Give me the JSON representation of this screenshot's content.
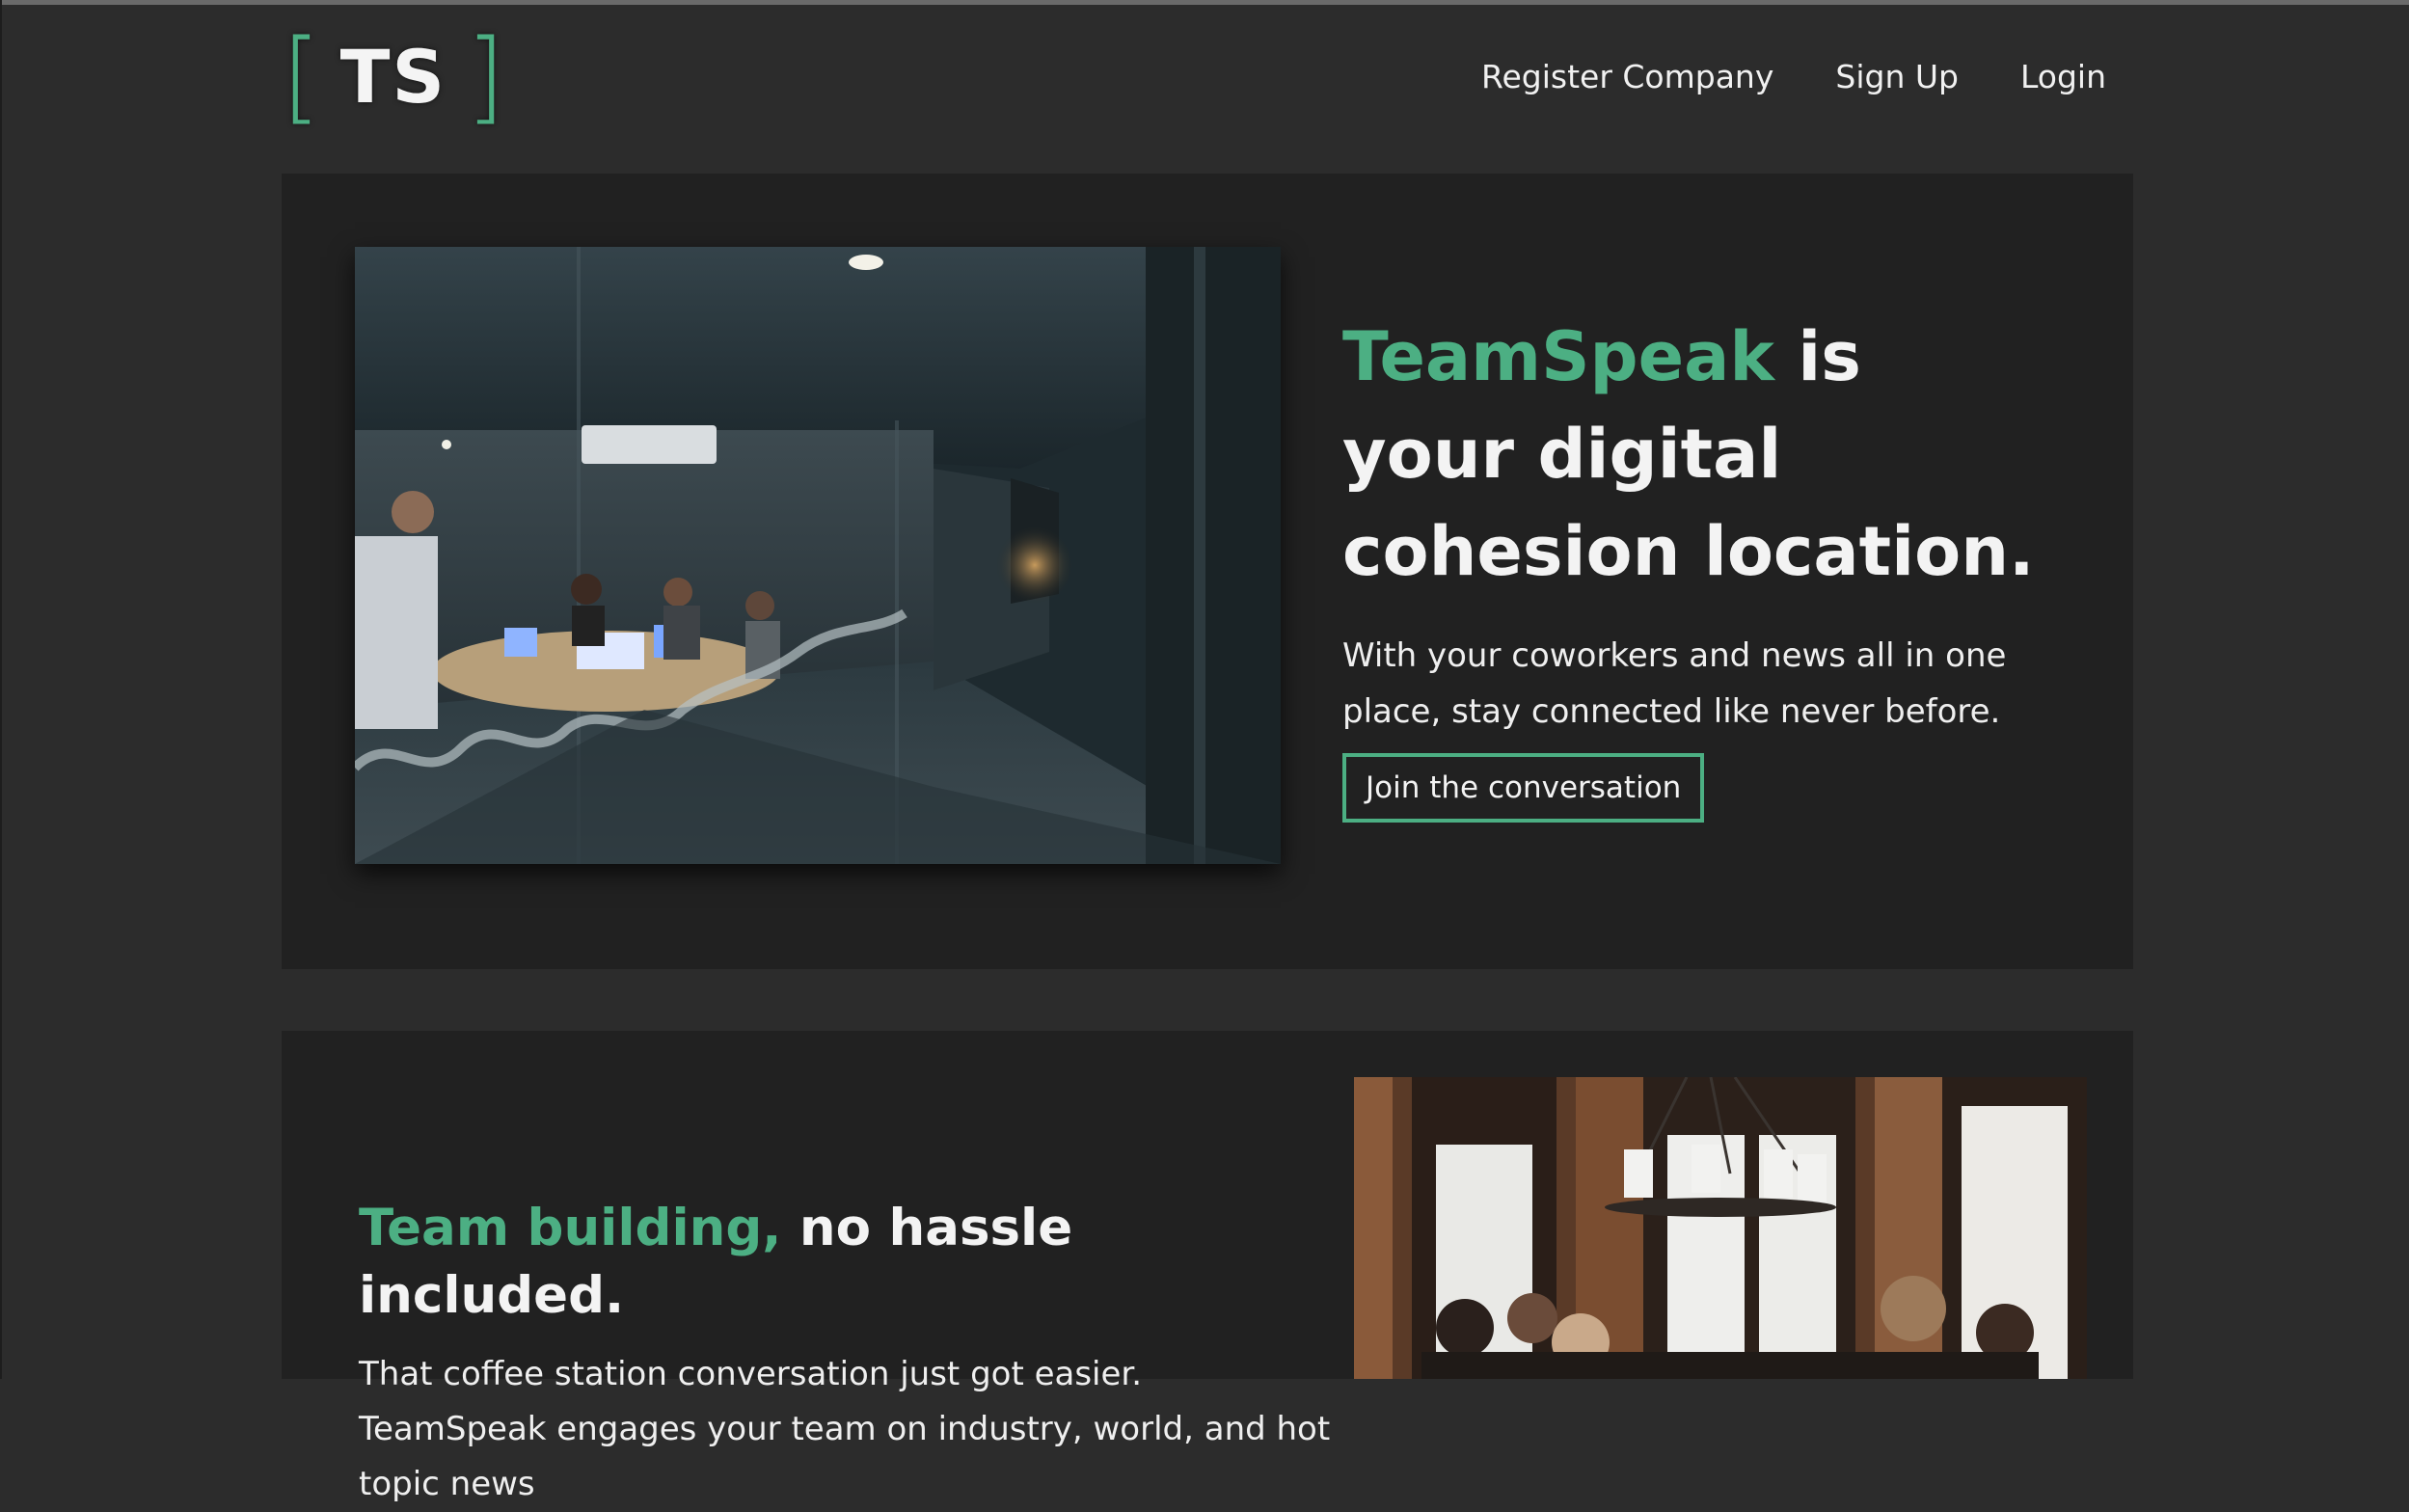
{
  "logo": {
    "left_bracket": "[",
    "letters": "TS",
    "right_bracket": "]"
  },
  "nav": {
    "items": [
      "Register Company",
      "Sign Up",
      "Login"
    ]
  },
  "hero": {
    "title_accent": "TeamSpeak",
    "title_rest": "is your digital cohesion location.",
    "subtitle": "With your coworkers and news all in one place, stay connected like never before.",
    "cta_label": "Join the conversation"
  },
  "feature": {
    "title_accent": "Team building,",
    "title_rest": "no hassle included.",
    "body": "That coffee station conversation just got easier. TeamSpeak engages your team on industry, world, and hot topic news"
  },
  "colors": {
    "accent": "#4caf83",
    "background": "#2c2c2c",
    "panel": "#212121",
    "text": "#f1f1f1"
  }
}
